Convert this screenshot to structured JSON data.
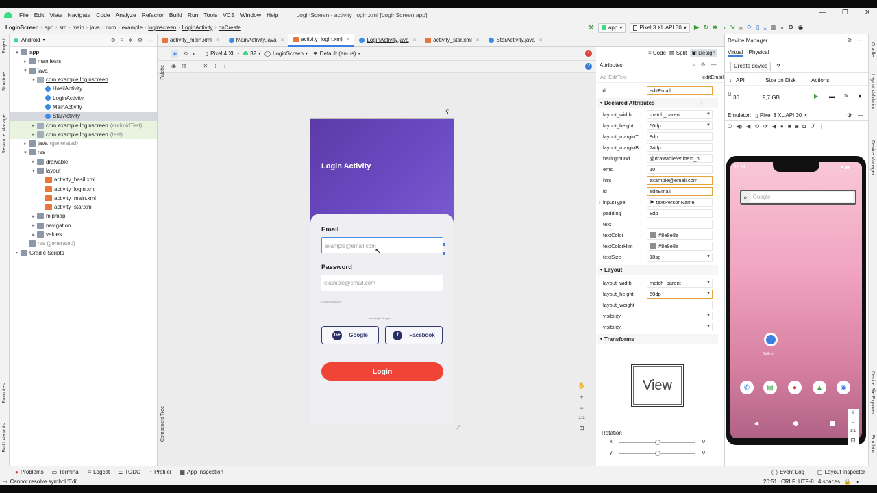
{
  "window": {
    "title": "LoginScreen - activity_login.xml [LoginScreen.app]"
  },
  "menu": [
    "File",
    "Edit",
    "View",
    "Navigate",
    "Code",
    "Analyze",
    "Refactor",
    "Build",
    "Run",
    "Tools",
    "VCS",
    "Window",
    "Help"
  ],
  "breadcrumb": [
    "LoginScreen",
    "app",
    "src",
    "main",
    "java",
    "com",
    "example",
    "loginscreen",
    "LoginActivity",
    "onCreate"
  ],
  "toolbar": {
    "run_config": "app",
    "device": "Pixel 3 XL API 30"
  },
  "side_tabs_left": [
    "Project",
    "Structure",
    "Resource Manager",
    "Favorites",
    "Build Variants"
  ],
  "side_tabs_right": [
    "Gradle",
    "Layout Validation",
    "Device Manager",
    "Device File Explorer",
    "Emulator"
  ],
  "project": {
    "view": "Android",
    "tree": [
      {
        "label": "app",
        "indent": 0,
        "icon": "folder",
        "arrow": "▾",
        "bold": true
      },
      {
        "label": "manifests",
        "indent": 1,
        "icon": "folder",
        "arrow": "▸"
      },
      {
        "label": "java",
        "indent": 1,
        "icon": "folder",
        "arrow": "▾"
      },
      {
        "label": "com.example.loginscreen",
        "indent": 2,
        "icon": "pkg",
        "arrow": "▾",
        "underline": true
      },
      {
        "label": "HasilActivity",
        "indent": 3,
        "icon": "cls",
        "arrow": ""
      },
      {
        "label": "LoginActivity",
        "indent": 3,
        "icon": "cls",
        "arrow": "",
        "underline": true
      },
      {
        "label": "MainActivity",
        "indent": 3,
        "icon": "cls",
        "arrow": ""
      },
      {
        "label": "StarActivity",
        "indent": 3,
        "icon": "cls",
        "arrow": "",
        "selected": true
      },
      {
        "label": "com.example.loginscreen",
        "suffix": "(androidTest)",
        "indent": 2,
        "icon": "pkg",
        "arrow": "▸",
        "hl": true
      },
      {
        "label": "com.example.loginscreen",
        "suffix": "(test)",
        "indent": 2,
        "icon": "pkg",
        "arrow": "▸",
        "hl": true
      },
      {
        "label": "java",
        "suffix": "(generated)",
        "indent": 1,
        "icon": "folder",
        "arrow": "▸"
      },
      {
        "label": "res",
        "indent": 1,
        "icon": "folder",
        "arrow": "▾"
      },
      {
        "label": "drawable",
        "indent": 2,
        "icon": "folder",
        "arrow": "▸"
      },
      {
        "label": "layout",
        "indent": 2,
        "icon": "folder",
        "arrow": "▾"
      },
      {
        "label": "activity_hasil.xml",
        "indent": 3,
        "icon": "xml",
        "arrow": ""
      },
      {
        "label": "activity_login.xml",
        "indent": 3,
        "icon": "xml",
        "arrow": ""
      },
      {
        "label": "activity_main.xml",
        "indent": 3,
        "icon": "xml",
        "arrow": ""
      },
      {
        "label": "activity_star.xml",
        "indent": 3,
        "icon": "xml",
        "arrow": ""
      },
      {
        "label": "mipmap",
        "indent": 2,
        "icon": "folder",
        "arrow": "▸"
      },
      {
        "label": "navigation",
        "indent": 2,
        "icon": "folder",
        "arrow": "▸"
      },
      {
        "label": "values",
        "indent": 2,
        "icon": "folder",
        "arrow": "▸"
      },
      {
        "label": "res (generated)",
        "indent": 1,
        "icon": "folder",
        "arrow": "",
        "grey": true
      },
      {
        "label": "Gradle Scripts",
        "indent": 0,
        "icon": "folder",
        "arrow": "▸"
      }
    ]
  },
  "editor_tabs": [
    {
      "label": "activity_main.xml",
      "icon": "xml"
    },
    {
      "label": "MainActivity.java",
      "icon": "cls"
    },
    {
      "label": "activity_login.xml",
      "icon": "xml",
      "active": true
    },
    {
      "label": "LoginActivity.java",
      "icon": "cls",
      "underline": true
    },
    {
      "label": "activity_star.xml",
      "icon": "xml"
    },
    {
      "label": "StarActivity.java",
      "icon": "cls"
    }
  ],
  "design": {
    "device": "Pixel 4 XL",
    "api": "32",
    "theme": "LoginScreen",
    "locale": "Default (en-us)",
    "view_modes": [
      "Code",
      "Split",
      "Design"
    ],
    "palette_label": "Palette",
    "component_tree_label": "Component Tree",
    "zoom_ratio": "1:1"
  },
  "preview": {
    "header_title": "Login Activity",
    "email_label": "Email",
    "email_hint": "example@email.com",
    "password_label": "Password",
    "password_hint": "example@email.com",
    "forgot": "Lupa Password?",
    "divider_text": "atau login dengan",
    "google_btn": "Google",
    "facebook_btn": "Facebook",
    "login_btn": "Login",
    "colors": {
      "header": "#6a46c0",
      "login": "#f04437",
      "social_border": "#333a70"
    }
  },
  "attributes": {
    "title": "Attributes",
    "component": "EditText",
    "component_id": "editEmail",
    "id_label": "id",
    "id_value": "editEmail",
    "declared_header": "Declared Attributes",
    "declared": [
      {
        "name": "layout_width",
        "value": "match_parent",
        "dd": true
      },
      {
        "name": "layout_height",
        "value": "50dp",
        "dd": true
      },
      {
        "name": "layout_marginT...",
        "value": "8dp"
      },
      {
        "name": "layout_marginB...",
        "value": "24dp"
      },
      {
        "name": "background",
        "value": "@drawable/edittext_b"
      },
      {
        "name": "ems",
        "value": "10"
      },
      {
        "name": "hint",
        "value": "example@email.com",
        "orange": true
      },
      {
        "name": "id",
        "value": "editEmail",
        "orange": true
      },
      {
        "name": "inputType",
        "value": "textPersonName",
        "expand": true
      },
      {
        "name": "padding",
        "value": "8dp"
      },
      {
        "name": "text",
        "value": ""
      },
      {
        "name": "textColor",
        "value": "#8e8e8e",
        "swatch": true
      },
      {
        "name": "textColorHint",
        "value": "#8e8e8e",
        "swatch": true
      },
      {
        "name": "textSize",
        "value": "18sp",
        "dd": true
      }
    ],
    "layout_header": "Layout",
    "layout": [
      {
        "name": "layout_width",
        "value": "match_parent",
        "dd": true
      },
      {
        "name": "layout_height",
        "value": "50dp",
        "dd": true,
        "orange": true
      },
      {
        "name": "layout_weight",
        "value": ""
      },
      {
        "name": "visibility",
        "value": "",
        "dd": true
      },
      {
        "name": "visibility",
        "value": "",
        "dd": true
      }
    ],
    "transforms_header": "Transforms",
    "view_box_label": "View",
    "rotation_label": "Rotation",
    "rotation": [
      {
        "axis": "x",
        "value": "0"
      },
      {
        "axis": "y",
        "value": "0"
      }
    ]
  },
  "device_manager": {
    "title": "Device Manager",
    "tabs": [
      "Virtual",
      "Physical"
    ],
    "create_btn": "Create device",
    "help": "?",
    "columns": [
      "API",
      "Size on Disk",
      "Actions"
    ],
    "row": {
      "api": "30",
      "size": "9,7 GB"
    },
    "emulator_label": "Emulator:",
    "emulator_name": "Pixel 3 XL API 30"
  },
  "emulator": {
    "time": "11:24",
    "search": "Google",
    "gallery": "Gallery",
    "zoom": "1:1"
  },
  "bottom_tools": [
    "Problems",
    "Terminal",
    "Logcat",
    "TODO",
    "Profiler",
    "App Inspection"
  ],
  "bottom_right_tools": [
    "Event Log",
    "Layout Inspector"
  ],
  "status": {
    "message": "Cannot resolve symbol 'Edi'",
    "position": "20:51",
    "line_sep": "CRLF",
    "encoding": "UTF-8",
    "indent": "4 spaces"
  }
}
